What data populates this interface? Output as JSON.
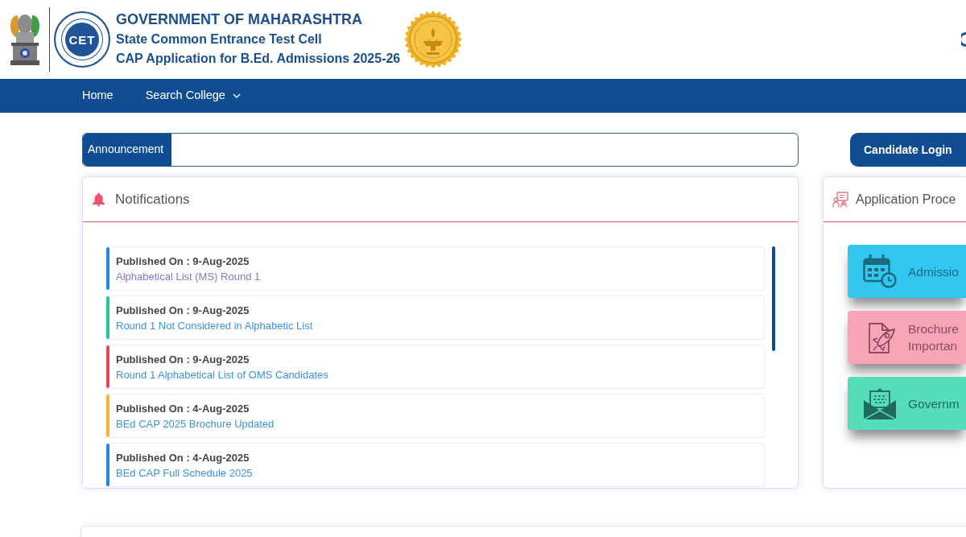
{
  "header": {
    "logo_text": "CET",
    "title": "GOVERNMENT OF MAHARASHTRA",
    "subtitle": "State Common Entrance Test Cell",
    "tagline": "CAP Application for B.Ed. Admissions 2025-26"
  },
  "nav": {
    "items": [
      {
        "label": "Home",
        "kind": "link"
      },
      {
        "label": "Search College",
        "kind": "dropdown"
      }
    ]
  },
  "announcement": {
    "label": "Announcement"
  },
  "notifications": {
    "title": "Notifications",
    "items": [
      {
        "published": "Published On : 9-Aug-2025",
        "link": "Alphabetical List (MS) Round 1",
        "color": "#1e88e5",
        "visited": true
      },
      {
        "published": "Published On : 9-Aug-2025",
        "link": "Round 1 Not Considered in Alphabetic List",
        "color": "#20c997",
        "visited": false
      },
      {
        "published": "Published On : 9-Aug-2025",
        "link": "Round 1 Alphabetical List of OMS Candidates",
        "color": "#e8445a",
        "visited": false
      },
      {
        "published": "Published On : 4-Aug-2025",
        "link": "BEd CAP 2025 Brochure Updated",
        "color": "#f7b52c",
        "visited": false
      },
      {
        "published": "Published On : 4-Aug-2025",
        "link": "BEd CAP Full Schedule 2025",
        "color": "#1e88e5",
        "visited": false
      }
    ]
  },
  "login_button": {
    "label": "Candidate Login"
  },
  "application_process": {
    "title": "Application Proce",
    "tiles": [
      {
        "kind": "calendar",
        "lines": [
          "Admissio"
        ],
        "color": "#33c6f0"
      },
      {
        "kind": "brochure",
        "lines": [
          "Brochure",
          "Importan"
        ],
        "color": "#f7a4b8"
      },
      {
        "kind": "mail",
        "lines": [
          "Governm"
        ],
        "color": "#55ddbb"
      }
    ]
  }
}
